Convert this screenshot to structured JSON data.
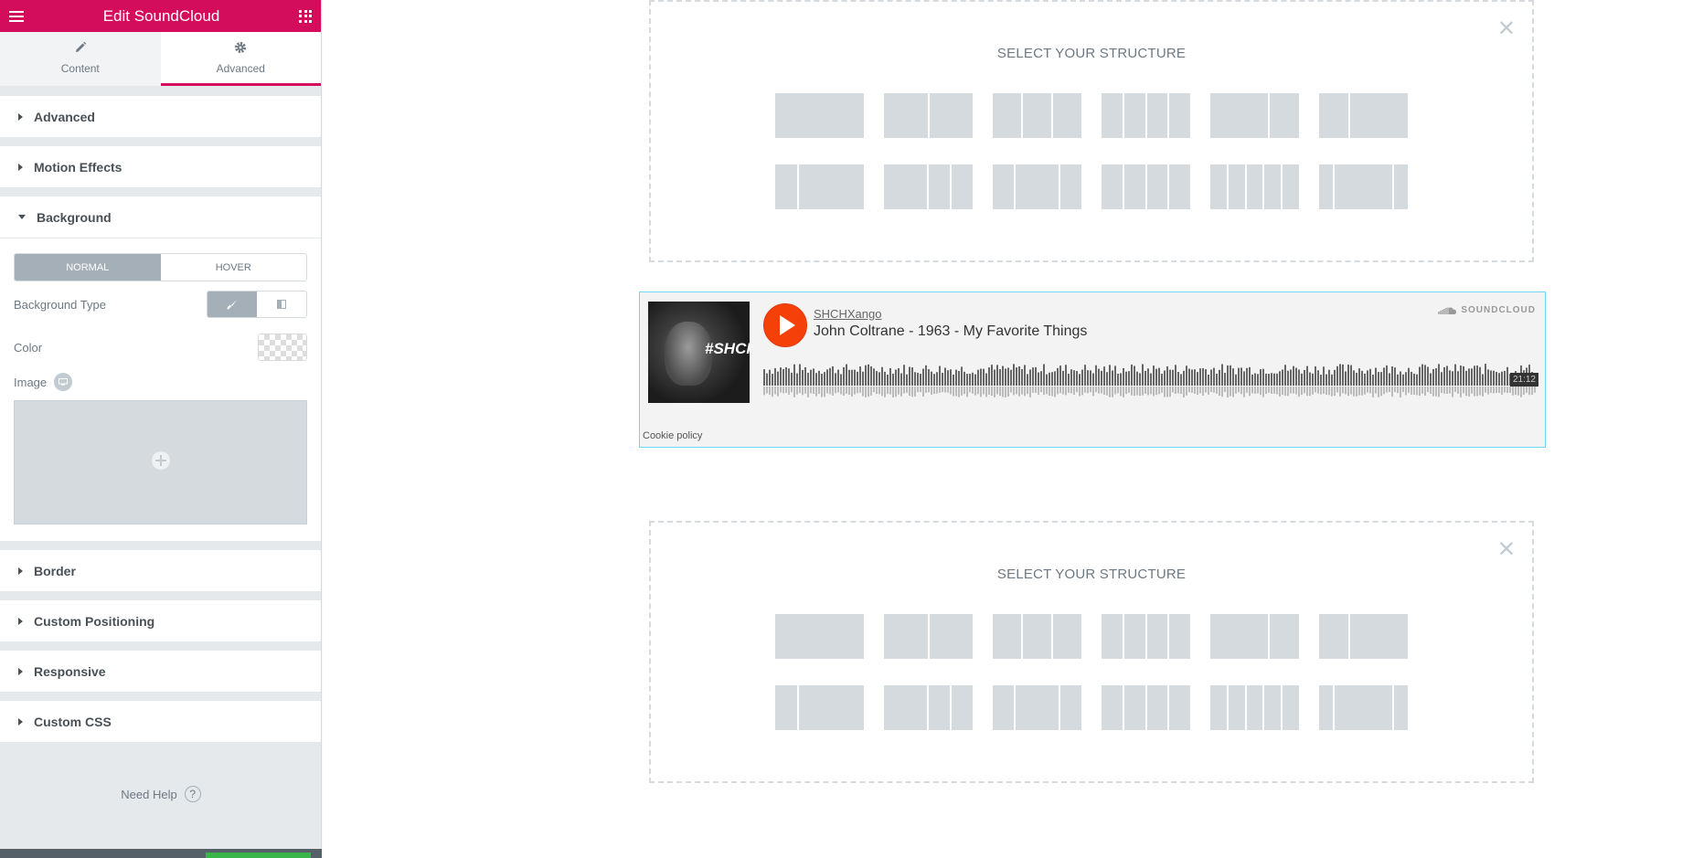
{
  "header": {
    "title": "Edit SoundCloud"
  },
  "tabs": [
    {
      "label": "Content",
      "icon": "pencil-icon"
    },
    {
      "label": "Advanced",
      "icon": "gear-icon"
    }
  ],
  "sections": {
    "advanced": "Advanced",
    "motion": "Motion Effects",
    "background": "Background",
    "border": "Border",
    "positioning": "Custom Positioning",
    "responsive": "Responsive",
    "css": "Custom CSS"
  },
  "background_panel": {
    "normal": "NORMAL",
    "hover": "HOVER",
    "type_label": "Background Type",
    "color_label": "Color",
    "image_label": "Image"
  },
  "help": {
    "label": "Need Help"
  },
  "structure": {
    "title": "SELECT YOUR STRUCTURE",
    "presets": [
      [
        100
      ],
      [
        50,
        50
      ],
      [
        33,
        33,
        33
      ],
      [
        25,
        25,
        25,
        25
      ],
      [
        66,
        33
      ],
      [
        33,
        66
      ],
      [
        25,
        75
      ],
      [
        50,
        25,
        25
      ],
      [
        25,
        50,
        25
      ],
      [
        25,
        25,
        25,
        25
      ],
      [
        20,
        20,
        20,
        20,
        20
      ],
      [
        16,
        66,
        16
      ]
    ]
  },
  "soundcloud": {
    "user": "SHCHXango",
    "track": "John Coltrane - 1963 - My Favorite Things",
    "brand": "SOUNDCLOUD",
    "art_text": "#SHCHX",
    "duration": "21:12",
    "cookie": "Cookie policy"
  },
  "colors": {
    "brand": "#d30c5c",
    "play": "#f5400a",
    "selection": "#71d7f7",
    "placeholder": "#d5dadf"
  }
}
